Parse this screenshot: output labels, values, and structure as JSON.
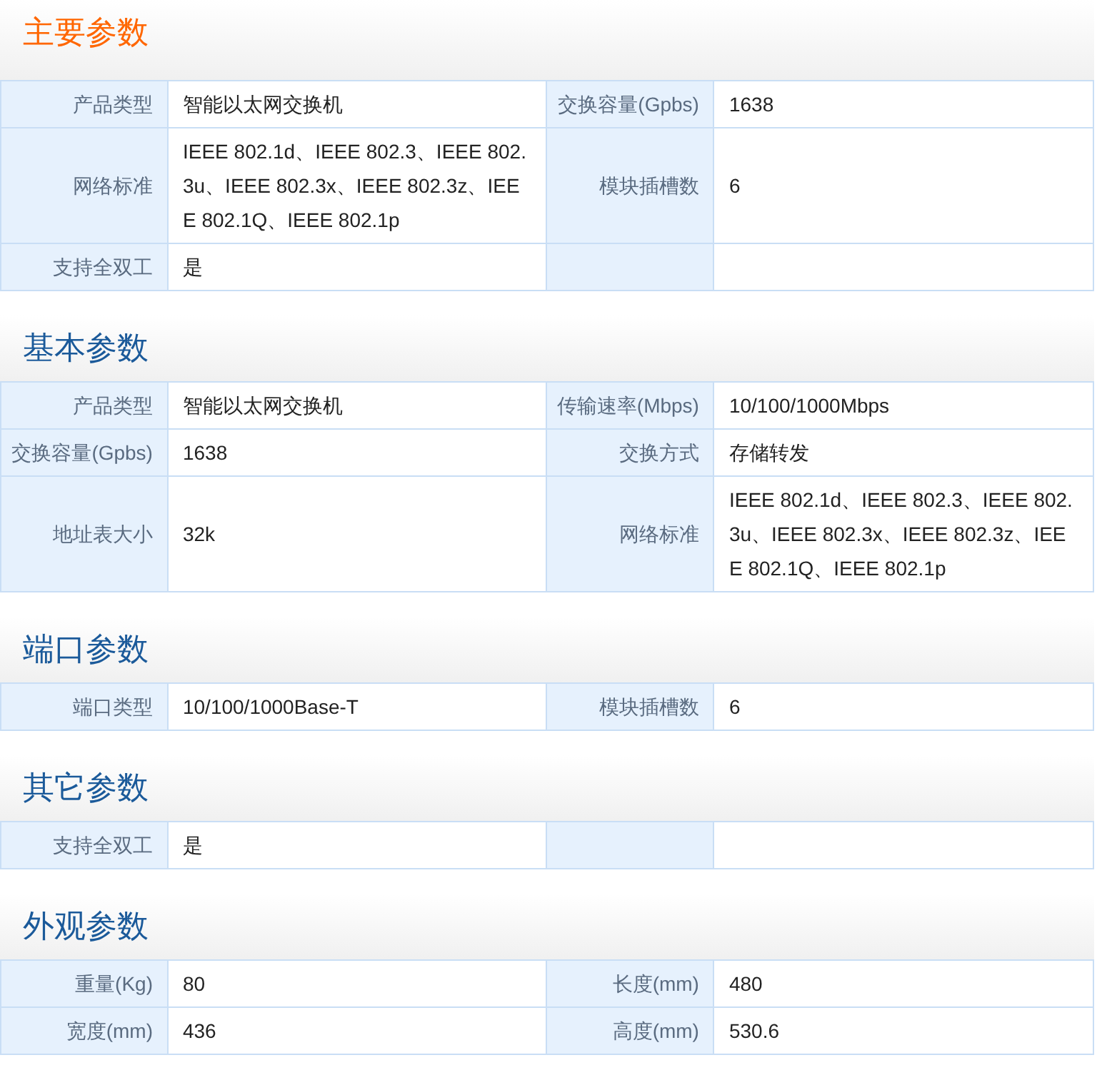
{
  "sections": [
    {
      "title": "主要参数",
      "kind": "primary",
      "rows": [
        [
          {
            "label": "产品类型",
            "value": "智能以太网交换机"
          },
          {
            "label": "交换容量(Gpbs)",
            "value": "1638"
          }
        ],
        [
          {
            "label": "网络标准",
            "value": "IEEE 802.1d、IEEE 802.3、IEEE 802.3u、IEEE 802.3x、IEEE 802.3z、IEEE 802.1Q、IEEE 802.1p"
          },
          {
            "label": "模块插槽数",
            "value": "6"
          }
        ],
        [
          {
            "label": "支持全双工",
            "value": "是"
          }
        ]
      ]
    },
    {
      "title": "基本参数",
      "kind": "normal",
      "rows": [
        [
          {
            "label": "产品类型",
            "value": "智能以太网交换机"
          },
          {
            "label": "传输速率(Mbps)",
            "value": "10/100/1000Mbps"
          }
        ],
        [
          {
            "label": "交换容量(Gpbs)",
            "value": "1638"
          },
          {
            "label": "交换方式",
            "value": "存储转发"
          }
        ],
        [
          {
            "label": "地址表大小",
            "value": "32k"
          },
          {
            "label": "网络标准",
            "value": "IEEE 802.1d、IEEE 802.3、IEEE 802.3u、IEEE 802.3x、IEEE 802.3z、IEEE 802.1Q、IEEE 802.1p"
          }
        ]
      ]
    },
    {
      "title": "端口参数",
      "kind": "normal",
      "rows": [
        [
          {
            "label": "端口类型",
            "value": "10/100/1000Base-T"
          },
          {
            "label": "模块插槽数",
            "value": "6"
          }
        ]
      ]
    },
    {
      "title": "其它参数",
      "kind": "normal",
      "rows": [
        [
          {
            "label": "支持全双工",
            "value": "是"
          }
        ]
      ]
    },
    {
      "title": "外观参数",
      "kind": "normal",
      "rows": [
        [
          {
            "label": "重量(Kg)",
            "value": "80"
          },
          {
            "label": "长度(mm)",
            "value": "480"
          }
        ],
        [
          {
            "label": "宽度(mm)",
            "value": "436"
          },
          {
            "label": "高度(mm)",
            "value": "530.6"
          }
        ]
      ]
    }
  ]
}
